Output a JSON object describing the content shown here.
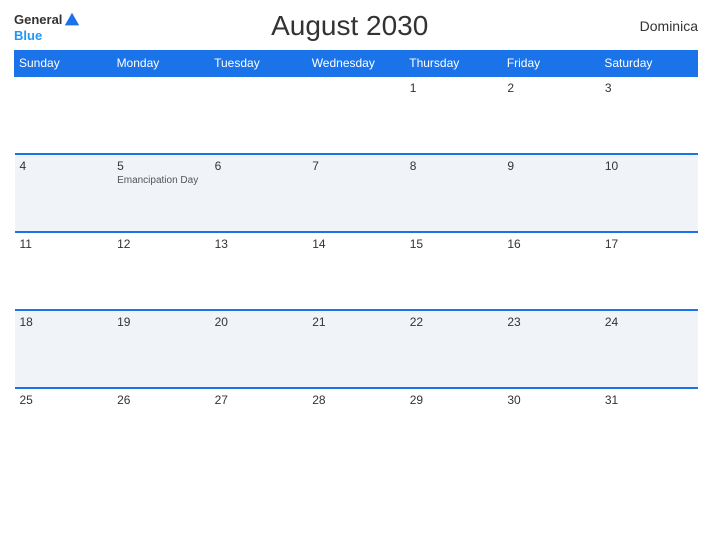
{
  "header": {
    "logo": {
      "general": "General",
      "blue": "Blue",
      "icon_title": "GeneralBlue logo"
    },
    "title": "August 2030",
    "country": "Dominica"
  },
  "weekdays": [
    "Sunday",
    "Monday",
    "Tuesday",
    "Wednesday",
    "Thursday",
    "Friday",
    "Saturday"
  ],
  "weeks": [
    [
      {
        "day": "",
        "holiday": ""
      },
      {
        "day": "",
        "holiday": ""
      },
      {
        "day": "",
        "holiday": ""
      },
      {
        "day": "",
        "holiday": ""
      },
      {
        "day": "1",
        "holiday": ""
      },
      {
        "day": "2",
        "holiday": ""
      },
      {
        "day": "3",
        "holiday": ""
      }
    ],
    [
      {
        "day": "4",
        "holiday": ""
      },
      {
        "day": "5",
        "holiday": "Emancipation Day"
      },
      {
        "day": "6",
        "holiday": ""
      },
      {
        "day": "7",
        "holiday": ""
      },
      {
        "day": "8",
        "holiday": ""
      },
      {
        "day": "9",
        "holiday": ""
      },
      {
        "day": "10",
        "holiday": ""
      }
    ],
    [
      {
        "day": "11",
        "holiday": ""
      },
      {
        "day": "12",
        "holiday": ""
      },
      {
        "day": "13",
        "holiday": ""
      },
      {
        "day": "14",
        "holiday": ""
      },
      {
        "day": "15",
        "holiday": ""
      },
      {
        "day": "16",
        "holiday": ""
      },
      {
        "day": "17",
        "holiday": ""
      }
    ],
    [
      {
        "day": "18",
        "holiday": ""
      },
      {
        "day": "19",
        "holiday": ""
      },
      {
        "day": "20",
        "holiday": ""
      },
      {
        "day": "21",
        "holiday": ""
      },
      {
        "day": "22",
        "holiday": ""
      },
      {
        "day": "23",
        "holiday": ""
      },
      {
        "day": "24",
        "holiday": ""
      }
    ],
    [
      {
        "day": "25",
        "holiday": ""
      },
      {
        "day": "26",
        "holiday": ""
      },
      {
        "day": "27",
        "holiday": ""
      },
      {
        "day": "28",
        "holiday": ""
      },
      {
        "day": "29",
        "holiday": ""
      },
      {
        "day": "30",
        "holiday": ""
      },
      {
        "day": "31",
        "holiday": ""
      }
    ]
  ],
  "colors": {
    "header_bg": "#1a73e8",
    "accent": "#2196f3",
    "border": "#1a73e8",
    "row_even_bg": "#f0f4f8",
    "row_odd_bg": "#ffffff"
  }
}
